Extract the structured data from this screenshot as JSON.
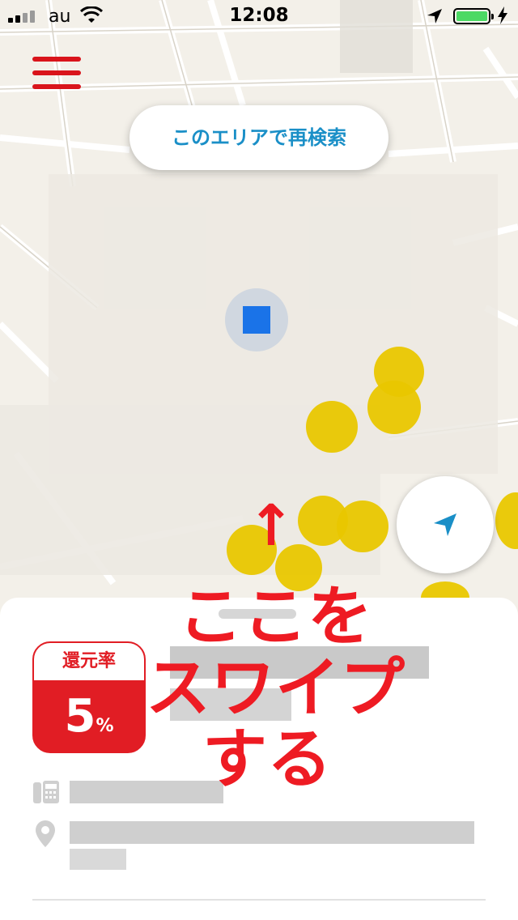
{
  "status_bar": {
    "carrier": "au",
    "time": "12:08",
    "battery_level": 1.0
  },
  "map": {
    "research_button": "このエリアで再検索",
    "icons": {
      "menu": "hamburger-menu-icon",
      "current_location": "current-location-marker",
      "locate": "navigation-arrow-icon"
    },
    "pin_color": "#e9c700"
  },
  "annotation": {
    "arrow": "↑",
    "line1": "ここを",
    "line2": "スワイプ",
    "line3": "する"
  },
  "store_card": {
    "rate_label": "還元率",
    "rate_value": "5",
    "rate_unit": "%",
    "icons": {
      "phone": "phone-icon",
      "address": "location-pin-icon"
    }
  },
  "colors": {
    "accent_red": "#e11d24",
    "link_blue": "#1a8fc7",
    "pin_yellow": "#e9c700"
  }
}
